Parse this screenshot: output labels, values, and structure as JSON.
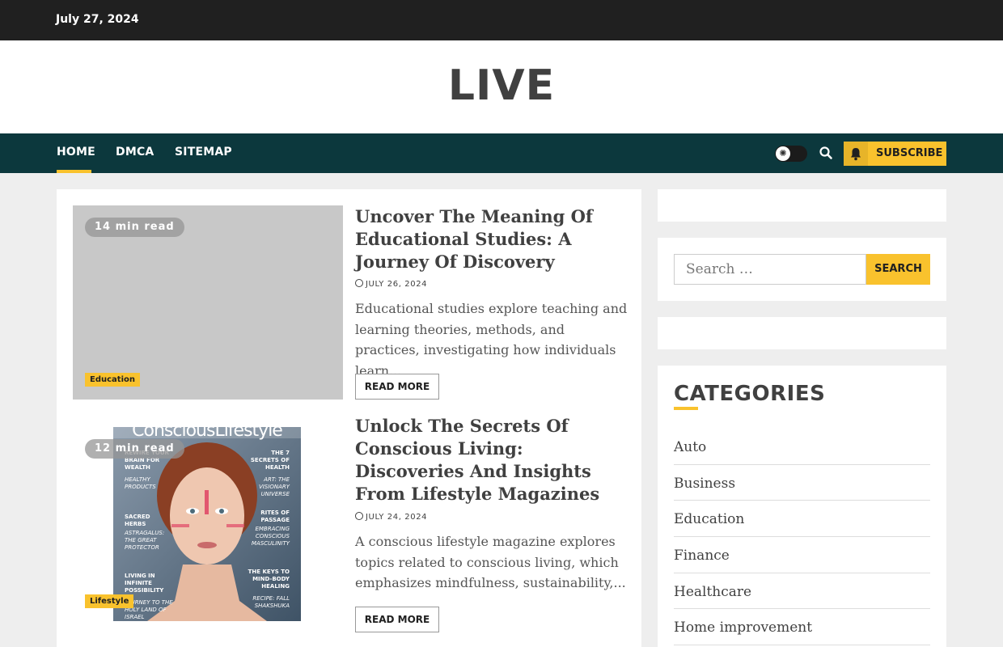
{
  "topbar": {
    "date": "July 27, 2024"
  },
  "site": {
    "logo": "LIVE"
  },
  "nav": {
    "items": [
      {
        "label": "HOME",
        "active": true
      },
      {
        "label": "DMCA",
        "active": false
      },
      {
        "label": "SITEMAP",
        "active": false
      }
    ],
    "subscribe_label": "SUBSCRIBE",
    "icons": {
      "theme_toggle": "sun-icon",
      "search": "search-icon",
      "subscribe": "bell-icon"
    }
  },
  "posts": [
    {
      "read_time": "14 min read",
      "category": "Education",
      "title": "Uncover The Meaning Of Educational Studies: A Journey Of Discovery",
      "date": "JULY 26, 2024",
      "excerpt": "Educational studies explore teaching and learning theories, methods, and practices, investigating how individuals learn...",
      "read_more": "READ MORE"
    },
    {
      "read_time": "12 min read",
      "category": "Lifestyle",
      "title": "Unlock The Secrets Of Conscious Living: Discoveries And Insights From Lifestyle Magazines",
      "date": "JULY 24, 2024",
      "excerpt": "A conscious lifestyle magazine explores topics related to conscious living, which emphasizes mindfulness, sustainability,...",
      "read_more": "READ MORE",
      "cover": {
        "masthead": "ConsciousLifestyle",
        "left_items": [
          "REWIRE YOUR BRAIN FOR WEALTH",
          "HEALTHY PRODUCTS",
          "SACRED HERBS",
          "ASTRAGALUS: THE GREAT PROTECTOR",
          "LIVING IN INFINITE POSSIBILITY",
          "JOURNEY TO THE HOLY LAND OF ISRAEL"
        ],
        "right_items": [
          "THE 7 SECRETS OF HEALTH",
          "ART: THE VISIONARY UNIVERSE",
          "RITES OF PASSAGE",
          "EMBRACING CONSCIOUS MASCULINITY",
          "THE KEYS TO MIND-BODY HEALING",
          "RECIPE: FALL SHAKSHUKA"
        ]
      }
    }
  ],
  "sidebar": {
    "search_placeholder": "Search …",
    "search_button": "SEARCH",
    "categories_title": "CATEGORIES",
    "categories": [
      "Auto",
      "Business",
      "Education",
      "Finance",
      "Healthcare",
      "Home improvement"
    ]
  },
  "colors": {
    "topbar": "#202020",
    "nav": "#0c383d",
    "accent": "#f9c22d",
    "background": "#eeeeee"
  }
}
